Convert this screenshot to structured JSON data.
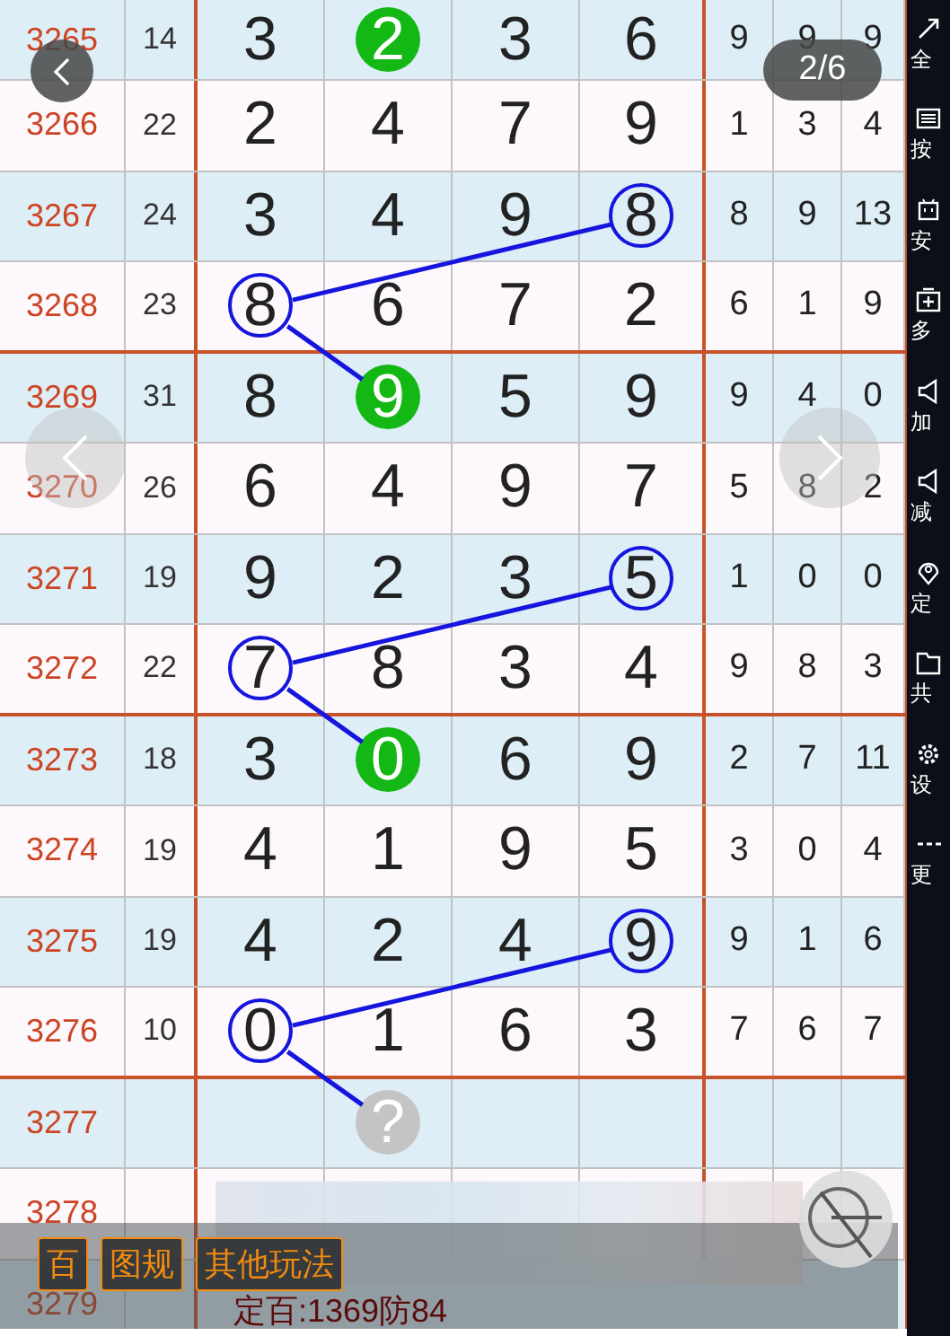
{
  "page_indicator": "2/6",
  "rows": [
    {
      "id": "3265",
      "sum": "14",
      "digits": [
        {
          "v": "3",
          "ringed": false
        },
        {
          "v": "2",
          "ringed": false,
          "color": "#14b814"
        },
        {
          "v": "3",
          "ringed": false
        },
        {
          "v": "6",
          "ringed": false
        }
      ],
      "tail": [
        "9",
        "9",
        "9"
      ]
    },
    {
      "id": "3266",
      "sum": "22",
      "digits": [
        {
          "v": "2",
          "ringed": false
        },
        {
          "v": "4",
          "ringed": false
        },
        {
          "v": "7",
          "ringed": false
        },
        {
          "v": "9",
          "ringed": false
        }
      ],
      "tail": [
        "1",
        "3",
        "4"
      ]
    },
    {
      "id": "3267",
      "sum": "24",
      "digits": [
        {
          "v": "3",
          "ringed": false
        },
        {
          "v": "4",
          "ringed": false
        },
        {
          "v": "9",
          "ringed": false
        },
        {
          "v": "8",
          "ringed": true
        }
      ],
      "tail": [
        "8",
        "9",
        "13"
      ]
    },
    {
      "id": "3268",
      "sum": "23",
      "digits": [
        {
          "v": "8",
          "ringed": true
        },
        {
          "v": "6",
          "ringed": false
        },
        {
          "v": "7",
          "ringed": false
        },
        {
          "v": "2",
          "ringed": false
        }
      ],
      "tail": [
        "6",
        "1",
        "9"
      ]
    },
    {
      "id": "3269",
      "sum": "31",
      "digits": [
        {
          "v": "8",
          "ringed": false
        },
        {
          "v": "9",
          "ringed": false,
          "color": "#14b814"
        },
        {
          "v": "5",
          "ringed": false
        },
        {
          "v": "9",
          "ringed": false
        }
      ],
      "tail": [
        "9",
        "4",
        "0"
      ]
    },
    {
      "id": "3270",
      "sum": "26",
      "digits": [
        {
          "v": "6",
          "ringed": false
        },
        {
          "v": "4",
          "ringed": false
        },
        {
          "v": "9",
          "ringed": false
        },
        {
          "v": "7",
          "ringed": false
        }
      ],
      "tail": [
        "5",
        "8",
        "2"
      ]
    },
    {
      "id": "3271",
      "sum": "19",
      "digits": [
        {
          "v": "9",
          "ringed": false
        },
        {
          "v": "2",
          "ringed": false
        },
        {
          "v": "3",
          "ringed": false
        },
        {
          "v": "5",
          "ringed": true
        }
      ],
      "tail": [
        "1",
        "0",
        "0"
      ]
    },
    {
      "id": "3272",
      "sum": "22",
      "digits": [
        {
          "v": "7",
          "ringed": true
        },
        {
          "v": "8",
          "ringed": false
        },
        {
          "v": "3",
          "ringed": false
        },
        {
          "v": "4",
          "ringed": false
        }
      ],
      "tail": [
        "9",
        "8",
        "3"
      ]
    },
    {
      "id": "3273",
      "sum": "18",
      "digits": [
        {
          "v": "3",
          "ringed": false
        },
        {
          "v": "0",
          "ringed": false,
          "color": "#14b814"
        },
        {
          "v": "6",
          "ringed": false
        },
        {
          "v": "9",
          "ringed": false
        }
      ],
      "tail": [
        "2",
        "7",
        "11"
      ]
    },
    {
      "id": "3274",
      "sum": "19",
      "digits": [
        {
          "v": "4",
          "ringed": false
        },
        {
          "v": "1",
          "ringed": false
        },
        {
          "v": "9",
          "ringed": false
        },
        {
          "v": "5",
          "ringed": false
        }
      ],
      "tail": [
        "3",
        "0",
        "4"
      ]
    },
    {
      "id": "3275",
      "sum": "19",
      "digits": [
        {
          "v": "4",
          "ringed": false
        },
        {
          "v": "2",
          "ringed": false
        },
        {
          "v": "4",
          "ringed": false
        },
        {
          "v": "9",
          "ringed": true
        }
      ],
      "tail": [
        "9",
        "1",
        "6"
      ]
    },
    {
      "id": "3276",
      "sum": "10",
      "digits": [
        {
          "v": "0",
          "ringed": true
        },
        {
          "v": "1",
          "ringed": false
        },
        {
          "v": "6",
          "ringed": false
        },
        {
          "v": "3",
          "ringed": false
        }
      ],
      "tail": [
        "7",
        "6",
        "7"
      ]
    },
    {
      "id": "3277",
      "digits": [
        {
          "ringed": false
        },
        {
          "v": "?",
          "ringed": false,
          "color": "#c4c4c4"
        },
        {
          "ringed": false
        },
        {
          "ringed": false
        }
      ]
    },
    {
      "id": "3278"
    },
    {
      "id": "3279",
      "note": "定百:1369防84"
    }
  ],
  "bottom_buttons": [
    "百",
    "图规",
    "其他玩法"
  ],
  "sidebar": [
    {
      "label": "全",
      "kind": "expand"
    },
    {
      "label": "按",
      "kind": "keyboard"
    },
    {
      "label": "安",
      "kind": "robot"
    },
    {
      "label": "多",
      "kind": "window"
    },
    {
      "label": "加",
      "kind": "speaker"
    },
    {
      "label": "减",
      "kind": "speaker"
    },
    {
      "label": "定",
      "kind": "pin"
    },
    {
      "label": "共",
      "kind": "folder"
    },
    {
      "label": "设",
      "kind": "gear"
    },
    {
      "label": "更",
      "kind": "dots"
    }
  ]
}
